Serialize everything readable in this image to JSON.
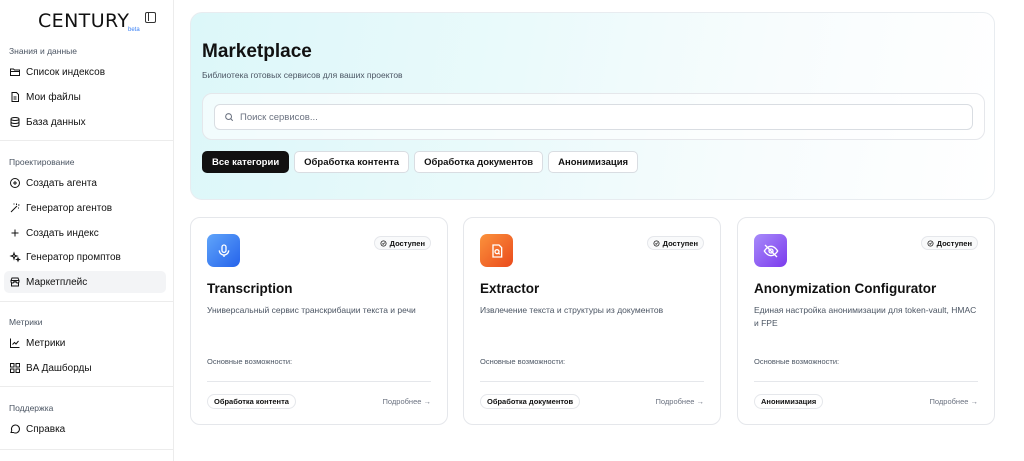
{
  "brand": {
    "name": "CENTURY",
    "badge": "beta"
  },
  "sidebar": {
    "groups": [
      {
        "label": "Знания и данные",
        "items": [
          {
            "label": "Список индексов",
            "icon": "folder-icon"
          },
          {
            "label": "Мои файлы",
            "icon": "file-icon"
          },
          {
            "label": "База данных",
            "icon": "database-icon"
          }
        ]
      },
      {
        "label": "Проектирование",
        "items": [
          {
            "label": "Создать агента",
            "icon": "plus-circle-icon"
          },
          {
            "label": "Генератор агентов",
            "icon": "wand-icon"
          },
          {
            "label": "Создать индекс",
            "icon": "plus-icon"
          },
          {
            "label": "Генератор промптов",
            "icon": "sparkles-icon"
          },
          {
            "label": "Маркетплейс",
            "icon": "store-icon"
          }
        ]
      },
      {
        "label": "Метрики",
        "items": [
          {
            "label": "Метрики",
            "icon": "chart-line-icon"
          },
          {
            "label": "BA Дашборды",
            "icon": "dashboard-icon"
          }
        ]
      },
      {
        "label": "Поддержка",
        "items": [
          {
            "label": "Справка",
            "icon": "help-chat-icon"
          }
        ]
      }
    ]
  },
  "hero": {
    "title": "Marketplace",
    "subtitle": "Библиотека готовых сервисов для ваших проектов",
    "search_placeholder": "Поиск сервисов...",
    "categories": [
      "Все категории",
      "Обработка контента",
      "Обработка документов",
      "Анонимизация"
    ],
    "active_category": "Все категории"
  },
  "cards": [
    {
      "title": "Transcription",
      "description": "Универсальный сервис транскрибации текста и речи",
      "status": "Доступен",
      "features_label": "Основные возможности:",
      "tag": "Обработка контента",
      "more": "Подробнее →",
      "icon": "microphone-icon",
      "color_from": "#60a5fa",
      "color_to": "#2563eb"
    },
    {
      "title": "Extractor",
      "description": "Извлечение текста и структуры из документов",
      "status": "Доступен",
      "features_label": "Основные возможности:",
      "tag": "Обработка документов",
      "more": "Подробнее →",
      "icon": "file-search-icon",
      "color_from": "#fb923c",
      "color_to": "#ea4a1c"
    },
    {
      "title": "Anonymization Configurator",
      "description": "Единая настройка анонимизации для token-vault, HMAC и FPE",
      "status": "Доступен",
      "features_label": "Основные возможности:",
      "tag": "Анонимизация",
      "more": "Подробнее →",
      "icon": "eye-off-icon",
      "color_from": "#a78bfa",
      "color_to": "#7c3aed"
    }
  ]
}
